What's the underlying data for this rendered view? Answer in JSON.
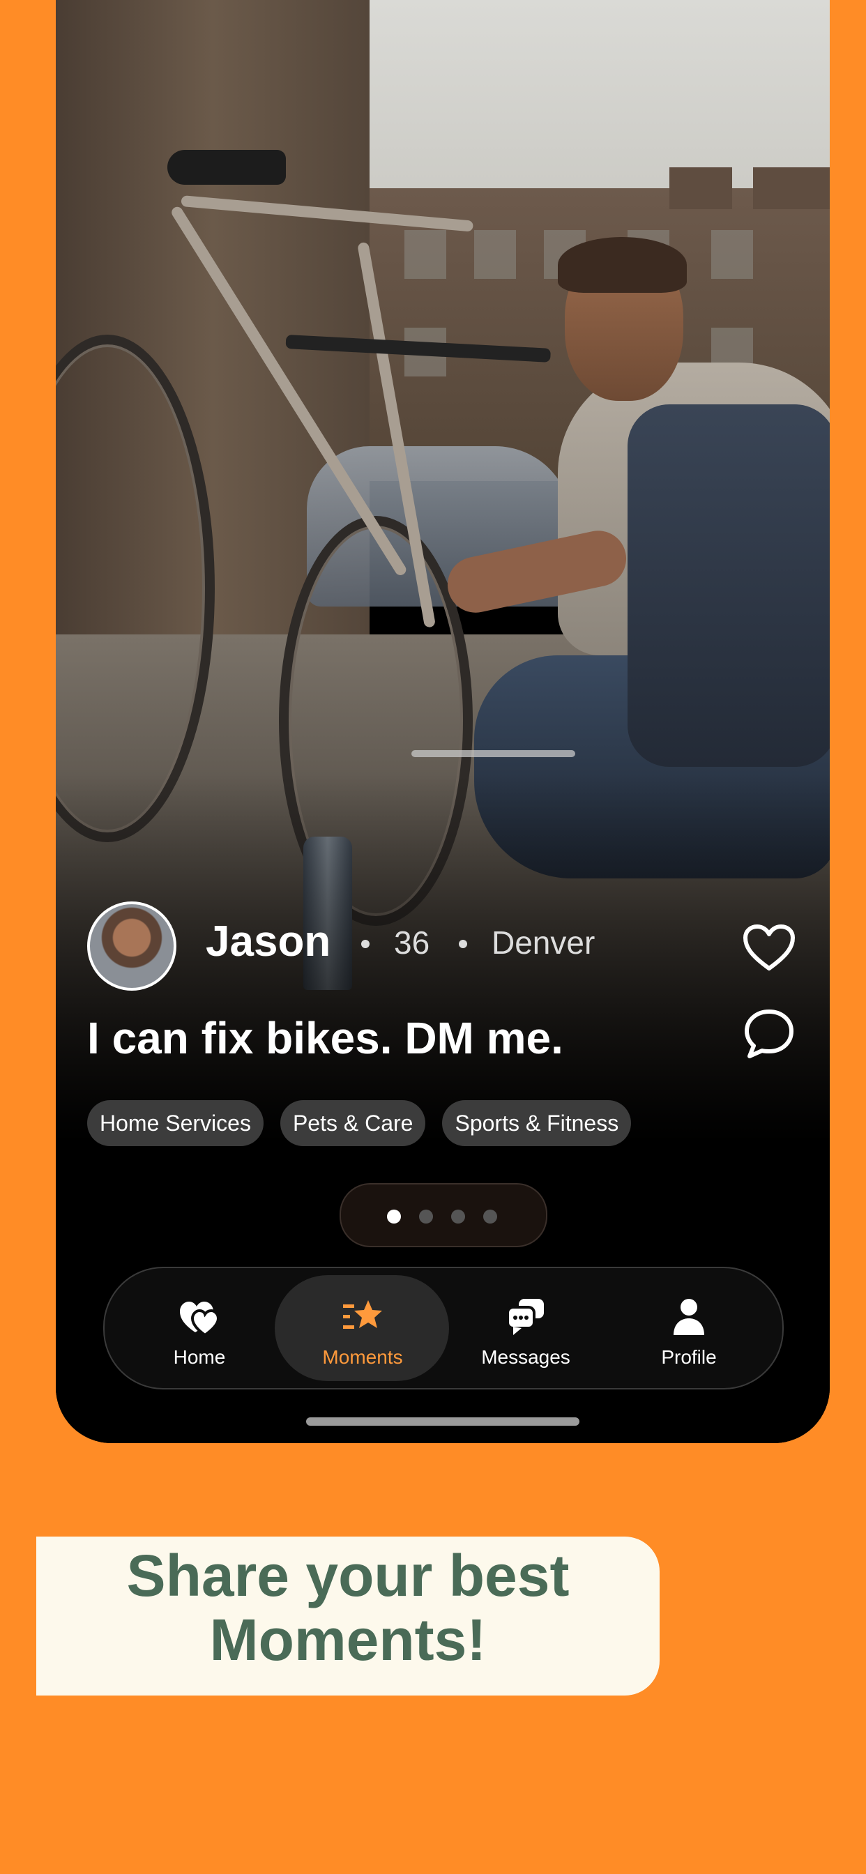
{
  "profile": {
    "name": "Jason",
    "age": "36",
    "city": "Denver",
    "tagline": "I can fix bikes. DM me."
  },
  "tags": [
    "Home Services",
    "Pets & Care",
    "Sports & Fitness"
  ],
  "pager": {
    "total": 4,
    "active_index": 0
  },
  "tabs": [
    {
      "label": "Home",
      "icon": "heart-stack-icon",
      "active": false
    },
    {
      "label": "Moments",
      "icon": "star-list-icon",
      "active": true
    },
    {
      "label": "Messages",
      "icon": "chat-bubbles-icon",
      "active": false
    },
    {
      "label": "Profile",
      "icon": "person-icon",
      "active": false
    }
  ],
  "banner": {
    "line1": "Share your best",
    "line2": "Moments!"
  },
  "colors": {
    "background": "#FF8C26",
    "accent": "#FF9A3C",
    "banner_bg": "#FDF9EC",
    "banner_text": "#4A6B57"
  }
}
